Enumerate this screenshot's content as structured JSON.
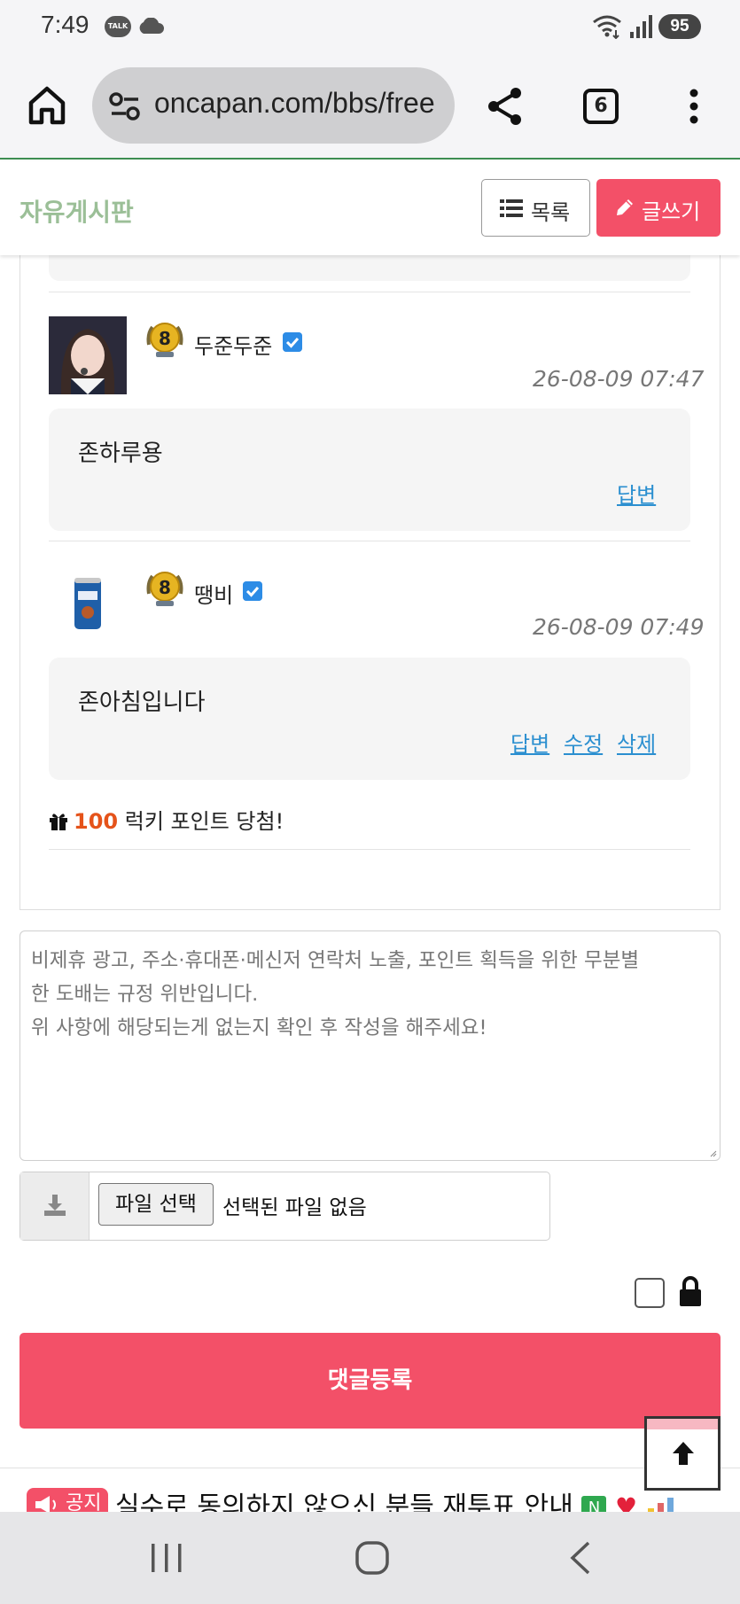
{
  "status_bar": {
    "time": "7:49",
    "talk_badge": "TALK",
    "battery": "95"
  },
  "browser": {
    "url": "oncapan.com/bbs/free",
    "tab_count": "6"
  },
  "board": {
    "title": "자유게시판",
    "list_label": "목록",
    "write_label": "글쓰기",
    "accent_color": "#f35068",
    "title_color": "#9bbf97"
  },
  "comments": [
    {
      "level": "8",
      "nickname": "두준두준",
      "date": "26-08-09 07:47",
      "text": "존하루용",
      "actions": [
        "답변"
      ]
    },
    {
      "level": "8",
      "nickname": "땡비",
      "date": "26-08-09 07:49",
      "text": "존아침입니다",
      "actions": [
        "답변",
        "수정",
        "삭제"
      ]
    }
  ],
  "lucky": {
    "points": "100",
    "text": "럭키 포인트 당첨!"
  },
  "form": {
    "placeholder_line1": "비제휴 광고, 주소·휴대폰·메신저 연락처 노출, 포인트 획득을 위한 무분별",
    "placeholder_line2": "한 도배는 규정 위반입니다.",
    "placeholder_line3": "위 사항에 해당되는게 없는지 확인 후 작성을 해주세요!",
    "file_button": "파일 선택",
    "file_none": "선택된 파일 없음",
    "submit_label": "댓글등록"
  },
  "notice": {
    "badge": "공지",
    "text": "실수로 동의하지 않으신 분들 재투표 안내",
    "n_badge": "N"
  }
}
